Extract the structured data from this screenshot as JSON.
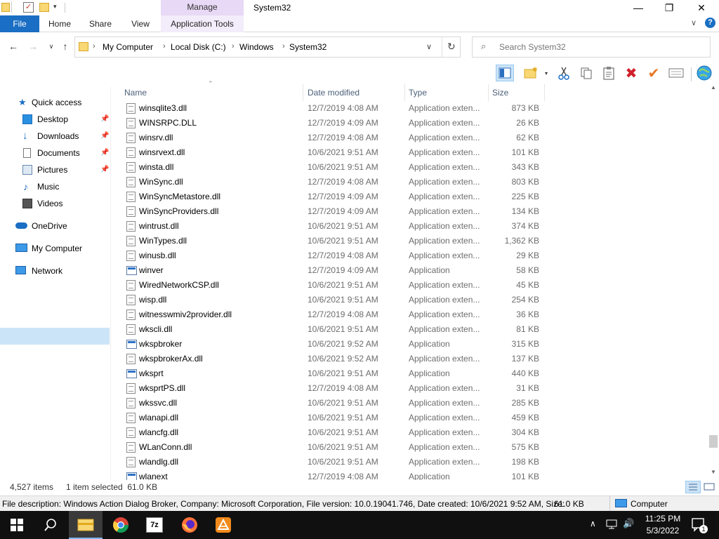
{
  "window": {
    "title": "System32",
    "context_tab_group": "Manage",
    "minimize": "—",
    "maximize": "❐",
    "close": "✕"
  },
  "ribbon": {
    "tabs": [
      "File",
      "Home",
      "Share",
      "View",
      "Application Tools"
    ]
  },
  "address": {
    "crumbs": [
      "My Computer",
      "Local Disk (C:)",
      "Windows",
      "System32"
    ]
  },
  "search": {
    "placeholder": "Search System32"
  },
  "nav": {
    "quick_access": "Quick access",
    "items": [
      "Desktop",
      "Downloads",
      "Documents",
      "Pictures",
      "Music",
      "Videos"
    ],
    "onedrive": "OneDrive",
    "my_computer": "My Computer",
    "network": "Network"
  },
  "columns": {
    "name": "Name",
    "date": "Date modified",
    "type": "Type",
    "size": "Size"
  },
  "files": [
    {
      "name": "winsqlite3.dll",
      "date": "12/7/2019 4:08 AM",
      "type": "Application exten...",
      "size": "873 KB",
      "icon": "dll"
    },
    {
      "name": "WINSRPC.DLL",
      "date": "12/7/2019 4:09 AM",
      "type": "Application exten...",
      "size": "26 KB",
      "icon": "dll"
    },
    {
      "name": "winsrv.dll",
      "date": "12/7/2019 4:08 AM",
      "type": "Application exten...",
      "size": "62 KB",
      "icon": "dll"
    },
    {
      "name": "winsrvext.dll",
      "date": "10/6/2021 9:51 AM",
      "type": "Application exten...",
      "size": "101 KB",
      "icon": "dll"
    },
    {
      "name": "winsta.dll",
      "date": "10/6/2021 9:51 AM",
      "type": "Application exten...",
      "size": "343 KB",
      "icon": "dll"
    },
    {
      "name": "WinSync.dll",
      "date": "12/7/2019 4:08 AM",
      "type": "Application exten...",
      "size": "803 KB",
      "icon": "dll"
    },
    {
      "name": "WinSyncMetastore.dll",
      "date": "12/7/2019 4:09 AM",
      "type": "Application exten...",
      "size": "225 KB",
      "icon": "dll"
    },
    {
      "name": "WinSyncProviders.dll",
      "date": "12/7/2019 4:09 AM",
      "type": "Application exten...",
      "size": "134 KB",
      "icon": "dll"
    },
    {
      "name": "wintrust.dll",
      "date": "10/6/2021 9:51 AM",
      "type": "Application exten...",
      "size": "374 KB",
      "icon": "dll"
    },
    {
      "name": "WinTypes.dll",
      "date": "10/6/2021 9:51 AM",
      "type": "Application exten...",
      "size": "1,362 KB",
      "icon": "dll"
    },
    {
      "name": "winusb.dll",
      "date": "12/7/2019 4:08 AM",
      "type": "Application exten...",
      "size": "29 KB",
      "icon": "dll"
    },
    {
      "name": "winver",
      "date": "12/7/2019 4:09 AM",
      "type": "Application",
      "size": "58 KB",
      "icon": "app"
    },
    {
      "name": "WiredNetworkCSP.dll",
      "date": "10/6/2021 9:51 AM",
      "type": "Application exten...",
      "size": "45 KB",
      "icon": "dll"
    },
    {
      "name": "wisp.dll",
      "date": "10/6/2021 9:51 AM",
      "type": "Application exten...",
      "size": "254 KB",
      "icon": "dll"
    },
    {
      "name": "witnesswmiv2provider.dll",
      "date": "12/7/2019 4:08 AM",
      "type": "Application exten...",
      "size": "36 KB",
      "icon": "dll"
    },
    {
      "name": "wkscli.dll",
      "date": "10/6/2021 9:51 AM",
      "type": "Application exten...",
      "size": "81 KB",
      "icon": "dll"
    },
    {
      "name": "wkspbroker",
      "date": "10/6/2021 9:52 AM",
      "type": "Application",
      "size": "315 KB",
      "icon": "app"
    },
    {
      "name": "wkspbrokerAx.dll",
      "date": "10/6/2021 9:52 AM",
      "type": "Application exten...",
      "size": "137 KB",
      "icon": "dll"
    },
    {
      "name": "wksprt",
      "date": "10/6/2021 9:51 AM",
      "type": "Application",
      "size": "440 KB",
      "icon": "app"
    },
    {
      "name": "wksprtPS.dll",
      "date": "12/7/2019 4:08 AM",
      "type": "Application exten...",
      "size": "31 KB",
      "icon": "dll"
    },
    {
      "name": "wkssvc.dll",
      "date": "10/6/2021 9:51 AM",
      "type": "Application exten...",
      "size": "285 KB",
      "icon": "dll"
    },
    {
      "name": "wlanapi.dll",
      "date": "10/6/2021 9:51 AM",
      "type": "Application exten...",
      "size": "459 KB",
      "icon": "dll"
    },
    {
      "name": "wlancfg.dll",
      "date": "10/6/2021 9:51 AM",
      "type": "Application exten...",
      "size": "304 KB",
      "icon": "dll"
    },
    {
      "name": "WLanConn.dll",
      "date": "10/6/2021 9:51 AM",
      "type": "Application exten...",
      "size": "575 KB",
      "icon": "dll"
    },
    {
      "name": "wlandlg.dll",
      "date": "10/6/2021 9:51 AM",
      "type": "Application exten...",
      "size": "198 KB",
      "icon": "dll"
    },
    {
      "name": "wlanext",
      "date": "12/7/2019 4:08 AM",
      "type": "Application",
      "size": "101 KB",
      "icon": "app"
    }
  ],
  "status": {
    "item_count": "4,527 items",
    "selection": "1 item selected  61.0 KB"
  },
  "details": {
    "text": "File description: Windows Action Dialog Broker, Company: Microsoft Corporation, File version: 10.0.19041.746, Date created: 10/6/2021 9:52 AM, Size:",
    "size": "61.0 KB",
    "location": "Computer"
  },
  "taskbar": {
    "time": "11:25 PM",
    "date": "5/3/2022",
    "notifications": "1"
  },
  "colors": {
    "file_tab": "#1a6ec3",
    "manage_band": "#e8d9f6",
    "selection": "#cce4f7",
    "taskbar": "#101010"
  }
}
